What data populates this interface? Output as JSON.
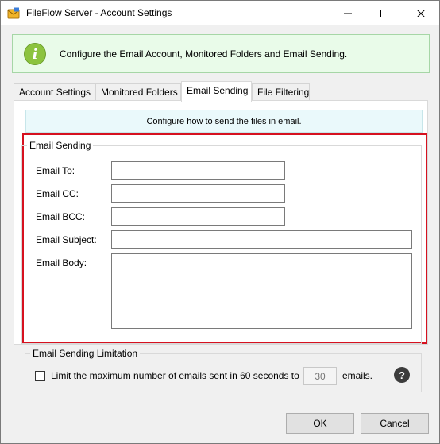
{
  "window": {
    "title": "FileFlow Server - Account Settings",
    "icon": "envelope-app-icon"
  },
  "banner": {
    "text": "Configure the Email Account, Monitored Folders and Email Sending.",
    "icon": "info-icon",
    "icon_glyph": "i"
  },
  "tabs": [
    {
      "label": "Account Settings",
      "active": false
    },
    {
      "label": "Monitored Folders",
      "active": false
    },
    {
      "label": "Email Sending",
      "active": true
    },
    {
      "label": "File Filtering",
      "active": false
    }
  ],
  "subbanner": {
    "text": "Configure how to send the files in email."
  },
  "email_sending": {
    "group_label": "Email Sending",
    "to_label": "Email To:",
    "to_value": "",
    "cc_label": "Email CC:",
    "cc_value": "",
    "bcc_label": "Email BCC:",
    "bcc_value": "",
    "subject_label": "Email Subject:",
    "subject_value": "",
    "body_label": "Email Body:",
    "body_value": ""
  },
  "limitation": {
    "group_label": "Email Sending Limitation",
    "checkbox_checked": false,
    "checkbox_label": "Limit the maximum number of emails sent in 60 seconds to",
    "max_emails": "30",
    "suffix": "emails.",
    "help_glyph": "?"
  },
  "buttons": {
    "ok": "OK",
    "cancel": "Cancel"
  },
  "colors": {
    "highlight_border": "#d6111f",
    "banner_bg": "#e9fbe9",
    "info_icon": "#8cc33f",
    "subbanner_bg": "#eaf9fb"
  }
}
